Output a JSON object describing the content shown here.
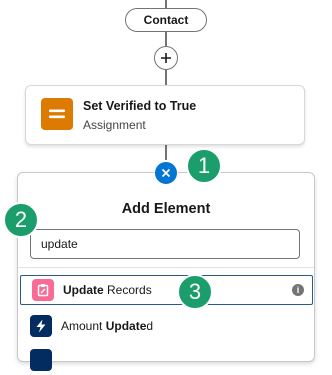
{
  "flow": {
    "contact_label": "Contact",
    "assignment": {
      "title": "Set Verified to True",
      "subtitle": "Assignment"
    }
  },
  "badges": [
    "1",
    "2",
    "3"
  ],
  "panel": {
    "title": "Add Element",
    "search_value": "update",
    "results": [
      {
        "bold": "Update",
        "rest": " Records",
        "icon": "update-records-icon",
        "info_icon": "info-icon"
      },
      {
        "pre": "Amount ",
        "bold": "Update",
        "post": "d",
        "icon": "lightning-icon"
      },
      {
        "icon": "flow-icon"
      }
    ]
  },
  "colors": {
    "assignment_icon": "#dd7a01",
    "update_records_icon": "#f86b95",
    "lightning_icon": "#032d60",
    "remove_button": "#0176d3",
    "badge": "#1b9e6b",
    "selected_border": "#2b5a8a"
  }
}
